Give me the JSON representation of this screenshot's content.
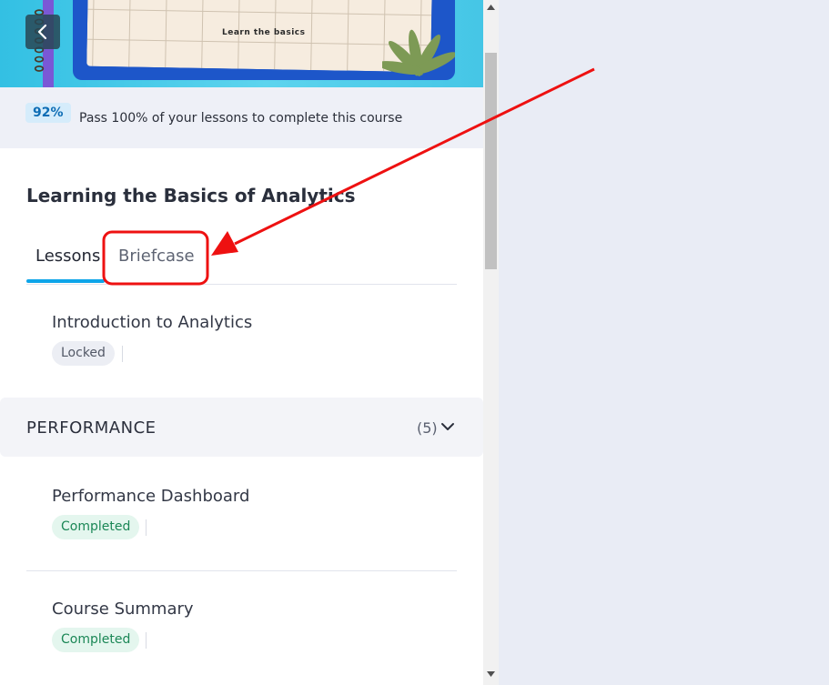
{
  "hero": {
    "caption": "Learn the basics"
  },
  "progress": {
    "percent": "92%",
    "message": "Pass 100% of your lessons to complete this course"
  },
  "course": {
    "title": "Learning the Basics of Analytics"
  },
  "tabs": [
    {
      "label": "Lessons",
      "active": true
    },
    {
      "label": "Briefcase",
      "active": false
    }
  ],
  "lessons_intro": {
    "title": "Introduction to Analytics",
    "status": "Locked"
  },
  "section": {
    "title": "PERFORMANCE",
    "count": "(5)"
  },
  "section_lessons": [
    {
      "title": "Performance Dashboard",
      "status": "Completed"
    },
    {
      "title": "Course Summary",
      "status": "Completed"
    }
  ],
  "colors": {
    "accent": "#0ea5e9",
    "annotation": "#ee1111",
    "completed": "#1b8756"
  },
  "icons": {
    "back": "chevron-left-icon",
    "expand": "chevron-down-icon"
  }
}
